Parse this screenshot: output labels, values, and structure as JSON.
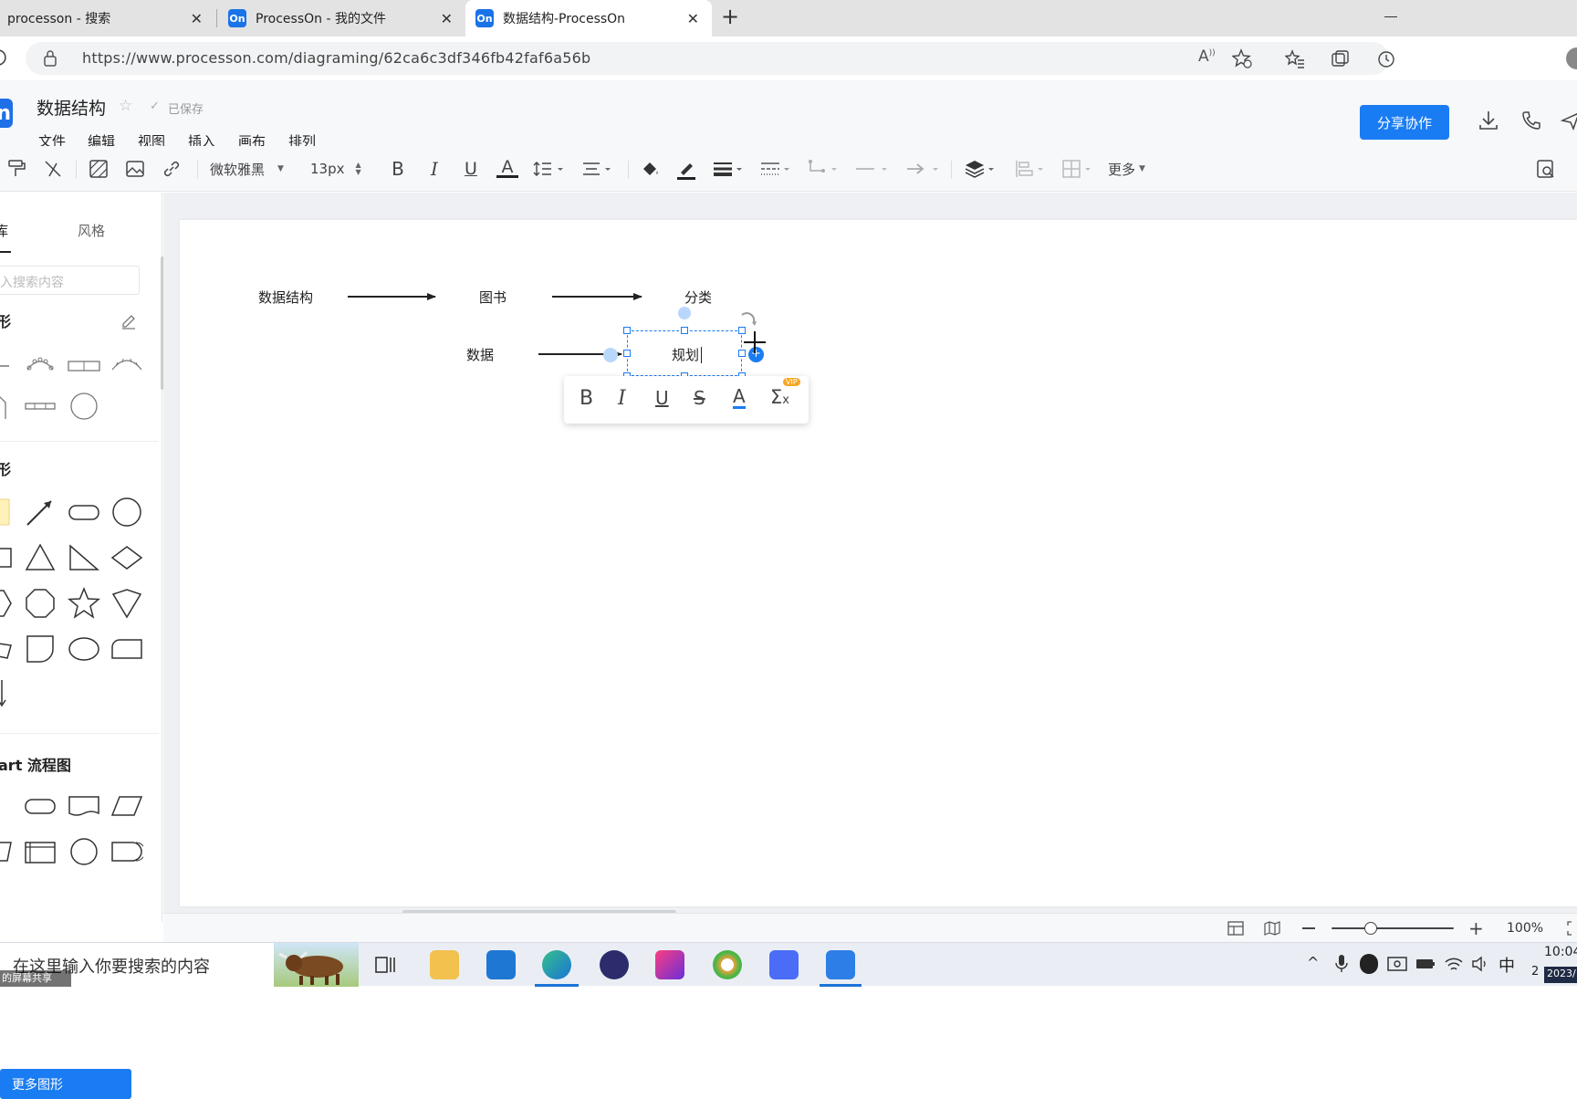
{
  "browser": {
    "tabs": [
      {
        "title": "processon - 搜索",
        "icon": "search-icon"
      },
      {
        "title": "ProcessOn - 我的文件",
        "icon": "processon-favicon",
        "favicon_text": "On"
      },
      {
        "title": "数据结构-ProcessOn",
        "icon": "processon-favicon",
        "favicon_text": "On",
        "active": true
      }
    ],
    "new_tab": "+",
    "url": "https://www.processon.com/diagraming/62ca6c3df346fb42faf6a56b"
  },
  "app": {
    "logo_text": "n",
    "doc_title": "数据结构",
    "saved_status": "已保存",
    "menu": [
      "文件",
      "编辑",
      "视图",
      "插入",
      "画布",
      "排列"
    ],
    "share_button": "分享协作"
  },
  "toolbar": {
    "font_family": "微软雅黑",
    "font_size": "13px",
    "more": "更多"
  },
  "sidebar": {
    "tabs": [
      "库",
      "风格"
    ],
    "search_placeholder": "入搜索内容",
    "section1": "形",
    "section2": "形",
    "section3": "art 流程图",
    "more_shapes": "更多图形"
  },
  "canvas": {
    "nodes": {
      "n1": "数据结构",
      "n2": "图书",
      "n3": "分类",
      "n4": "数据",
      "n5": "规划"
    },
    "text_toolbar": {
      "vip_badge": "VIP"
    }
  },
  "statusbar": {
    "zoom": "100%"
  },
  "taskbar": {
    "search_placeholder": "在这里输入你要搜索的内容",
    "input_method": "中",
    "time": "10:04",
    "date_partial": "2",
    "date_badge": "2023/",
    "overlay_text": "的屏幕共享"
  }
}
